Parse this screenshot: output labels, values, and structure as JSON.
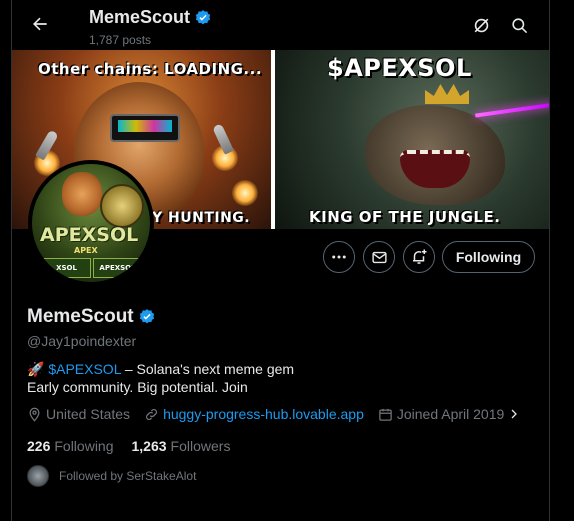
{
  "header": {
    "name": "MemeScout",
    "posts": "1,787 posts"
  },
  "banner": {
    "left_text_top": "Other chains: LOADING...",
    "left_text_bottom": "Y HUNTING.",
    "right_text_top": "$APEXSOL",
    "right_text_bottom": "KING OF THE JUNGLE."
  },
  "avatar": {
    "title": "APEXSOL",
    "subtitle": "APEX",
    "strip": [
      "XSOL",
      "APEXSOL"
    ]
  },
  "actions": {
    "following_label": "Following"
  },
  "profile": {
    "name": "MemeScout",
    "handle": "@Jay1poindexter",
    "bio_emoji": "🚀",
    "bio_tag": "$APEXSOL",
    "bio_rest": " – Solana's next meme gem",
    "bio_line2": "Early community. Big potential. Join",
    "location": "United States",
    "website": "huggy-progress-hub.lovable.app",
    "joined": "Joined April 2019"
  },
  "stats": {
    "following_count": "226",
    "following_label": "Following",
    "followers_count": "1,263",
    "followers_label": "Followers"
  },
  "followed_by": "Followed by SerStakeAlot",
  "colors": {
    "accent": "#1d9bf0",
    "muted": "#71767b",
    "text": "#e7e9ea",
    "border": "#2f3336",
    "background": "#000000"
  }
}
